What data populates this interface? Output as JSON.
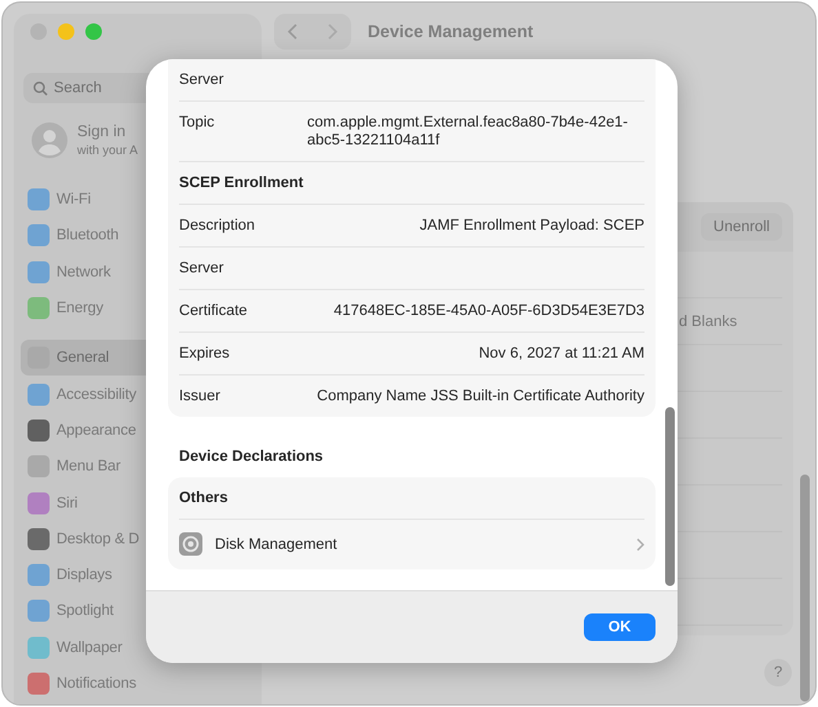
{
  "window": {
    "title": "Device Management"
  },
  "sidebar": {
    "search": {
      "placeholder": "Search"
    },
    "account": {
      "title": "Sign in",
      "subtitle": "with your A"
    },
    "groups": [
      [
        {
          "label": "Wi-Fi",
          "selected": false,
          "color": "#6fa3d2"
        },
        {
          "label": "Bluetooth",
          "selected": false,
          "color": "#6fa3d2"
        },
        {
          "label": "Network",
          "selected": false,
          "color": "#6fa3d2"
        },
        {
          "label": "Energy",
          "selected": false,
          "color": "#7dbb7d"
        }
      ],
      [
        {
          "label": "General",
          "selected": true,
          "color": "#a9a9a9"
        },
        {
          "label": "Accessibility",
          "selected": false,
          "color": "#6fa3d2"
        },
        {
          "label": "Appearance",
          "selected": false,
          "color": "#606060"
        },
        {
          "label": "Menu Bar",
          "selected": false,
          "color": "#a9a9a9"
        },
        {
          "label": "Siri",
          "selected": false,
          "color": "#b080c0"
        },
        {
          "label": "Desktop & D",
          "selected": false,
          "color": "#6a6a6a"
        },
        {
          "label": "Displays",
          "selected": false,
          "color": "#6fa3d2"
        },
        {
          "label": "Spotlight",
          "selected": false,
          "color": "#6fa3d2"
        },
        {
          "label": "Wallpaper",
          "selected": false,
          "color": "#70bccc"
        },
        {
          "label": "Notifications",
          "selected": false,
          "color": "#cc6f6f"
        }
      ]
    ]
  },
  "content": {
    "unenroll_button": "Unenroll",
    "row_text": "d Blanks",
    "help_button": "?"
  },
  "dialog": {
    "rows": [
      {
        "kind": "field",
        "label": "Server",
        "value": ""
      },
      {
        "kind": "field",
        "label": "Topic",
        "value": "com.apple.mgmt.External.feac8a80-7b4e-42e1-abc5-13221104a11f"
      },
      {
        "kind": "header",
        "label": "SCEP Enrollment"
      },
      {
        "kind": "field",
        "label": "Description",
        "value": "JAMF Enrollment Payload: SCEP"
      },
      {
        "kind": "field",
        "label": "Server",
        "value": ""
      },
      {
        "kind": "field",
        "label": "Certificate",
        "value": "417648EC-185E-45A0-A05F-6D3D54E3E7D3"
      },
      {
        "kind": "field",
        "label": "Expires",
        "value": "Nov 6, 2027 at 11:21 AM"
      },
      {
        "kind": "field",
        "label": "Issuer",
        "value": "Company Name JSS Built-in Certificate Authority"
      }
    ],
    "declarations": {
      "title": "Device Declarations",
      "groups": [
        {
          "title": "Others",
          "items": [
            {
              "label": "Disk Management"
            }
          ]
        }
      ]
    },
    "buttons": [
      {
        "label": "OK",
        "default": true
      }
    ]
  }
}
